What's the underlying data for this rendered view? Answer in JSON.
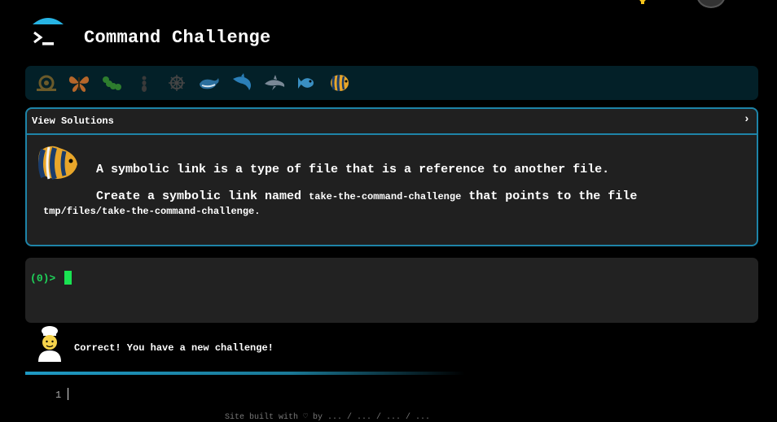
{
  "header": {
    "title": "Command Challenge",
    "logo_icon": "terminal-prompt-icon"
  },
  "top_bar": {
    "icons": [
      "lightbulb-icon",
      "user-avatar-icon"
    ]
  },
  "levels": [
    {
      "name": "snail-icon",
      "color": "#6b5a2a"
    },
    {
      "name": "butterfly-icon",
      "color": "#b5662a"
    },
    {
      "name": "caterpillar-icon",
      "color": "#2e7d2e"
    },
    {
      "name": "ant-icon",
      "color": "#3a3a3a"
    },
    {
      "name": "ship-wheel-icon",
      "color": "#444444"
    },
    {
      "name": "whale-icon",
      "color": "#2b6f9e"
    },
    {
      "name": "dolphin-icon",
      "color": "#2b7fb8"
    },
    {
      "name": "dolphin-grey-icon",
      "color": "#7a8896"
    },
    {
      "name": "fish-icon",
      "color": "#3a8fc2"
    },
    {
      "name": "tropical-fish-icon",
      "color": "#e8a62a"
    }
  ],
  "challenge": {
    "solutions_label": "View Solutions",
    "chevron": "›",
    "line1": "A symbolic link is a type of file that is a reference to another file.",
    "line2_prefix": "Create a symbolic link named ",
    "line2_code": "take-the-command-challenge",
    "line2_suffix": " that points to the file",
    "line3_code": "tmp/files/take-the-command-challenge",
    "line3_suffix": "."
  },
  "terminal": {
    "prompt_open": "(",
    "prompt_num": "0",
    "prompt_close": ")>"
  },
  "status": {
    "message": "Correct! You have a new challenge!"
  },
  "editor": {
    "line_number": "1"
  },
  "footer": {
    "text": "Site built with ♡ by ... / ... / ... / ..."
  },
  "colors": {
    "accent": "#1e84a8",
    "level_bar_bg": "#032028",
    "panel_bg": "#202020",
    "terminal_bg": "#222222",
    "prompt_green": "#1fd35a"
  }
}
